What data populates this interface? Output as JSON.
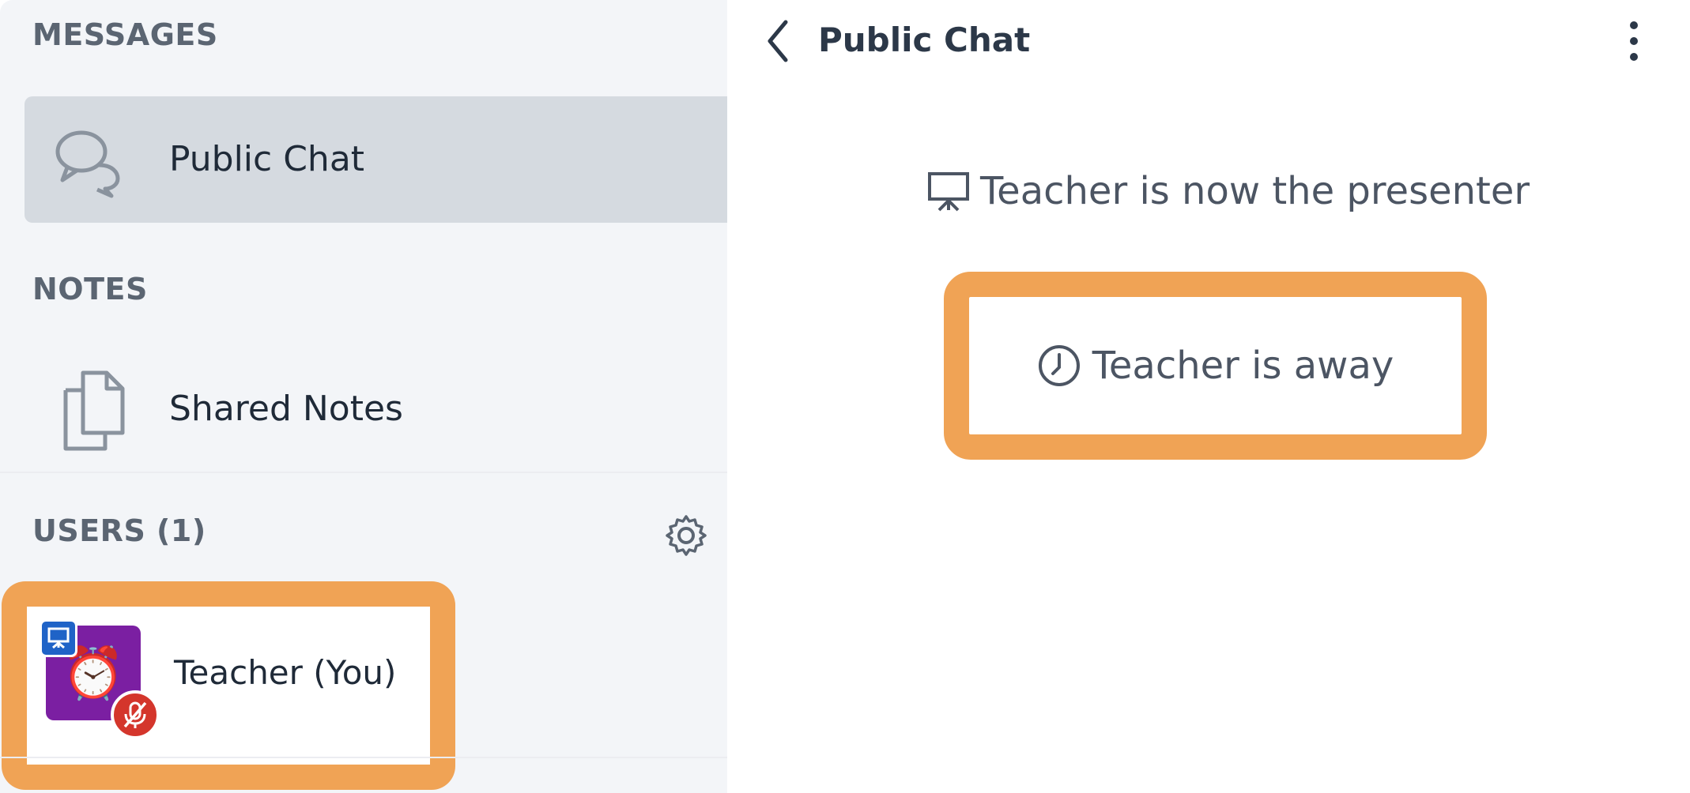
{
  "sidebar": {
    "messages_title": "MESSAGES",
    "public_chat_label": "Public Chat",
    "notes_title": "NOTES",
    "shared_notes_label": "Shared Notes",
    "users_title": "USERS (1)",
    "user": {
      "name": "Teacher (You)",
      "avatar_emoji": "⏰",
      "avatar_color": "#7b1fa2",
      "presenter_badge_color": "#1f63c7",
      "muted_badge_color": "#d4362c"
    }
  },
  "main": {
    "title": "Public Chat",
    "messages": [
      {
        "icon": "presentation-icon",
        "text": "Teacher is now the presenter"
      },
      {
        "icon": "clock-icon",
        "text": "Teacher is away"
      }
    ]
  },
  "colors": {
    "highlight": "#f0a355",
    "sidebar_bg": "#f3f5f8",
    "selected_item_bg": "#d5dae0"
  }
}
